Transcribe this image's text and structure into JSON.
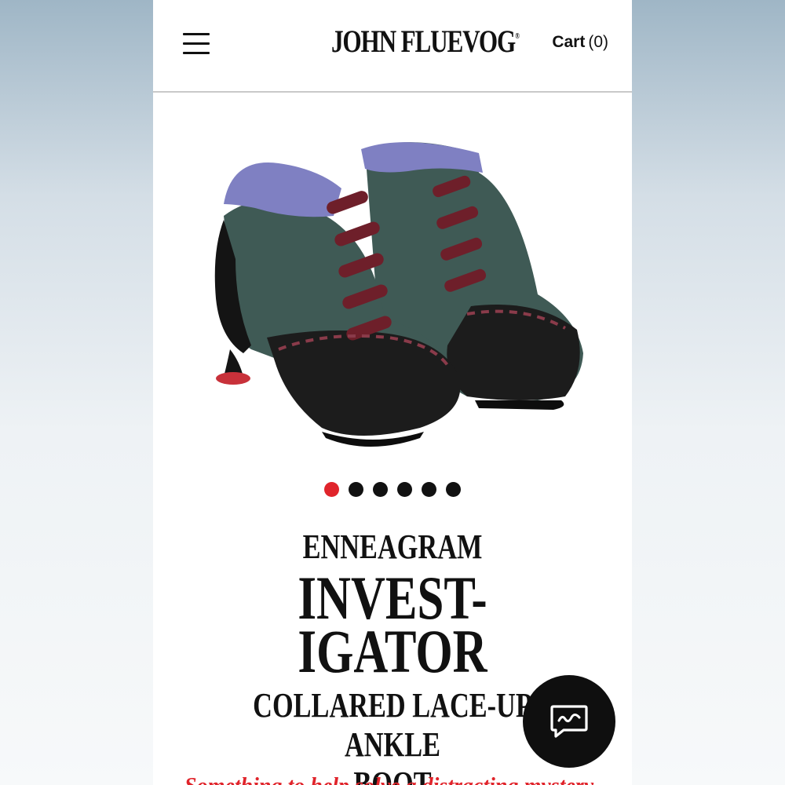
{
  "header": {
    "logo_text": "JOHN FLUEVOG",
    "logo_mark": "®",
    "cart_label": "Cart",
    "cart_count": "(0)",
    "menu_icon": "hamburger-menu-icon"
  },
  "product": {
    "image_alt": "Pair of collared lace-up ankle boots",
    "colors": {
      "collar": "#7f80c2",
      "upper": "#3f5a55",
      "vamp": "#1c1c1c",
      "laces": "#6e1f2a",
      "heel_tip": "#c8313a"
    },
    "carousel": {
      "total": 6,
      "active_index": 0,
      "active_color": "#e0242b"
    },
    "collection": "ENNEAGRAM",
    "name_line1": "INVEST-",
    "name_line2": "IGATOR",
    "subtitle_line1": "COLLARED LACE-UP ANKLE",
    "subtitle_line2": "BOOT",
    "tagline": "Something to help solve a distracting mystery"
  },
  "chat": {
    "icon": "chat-bubble-icon"
  }
}
